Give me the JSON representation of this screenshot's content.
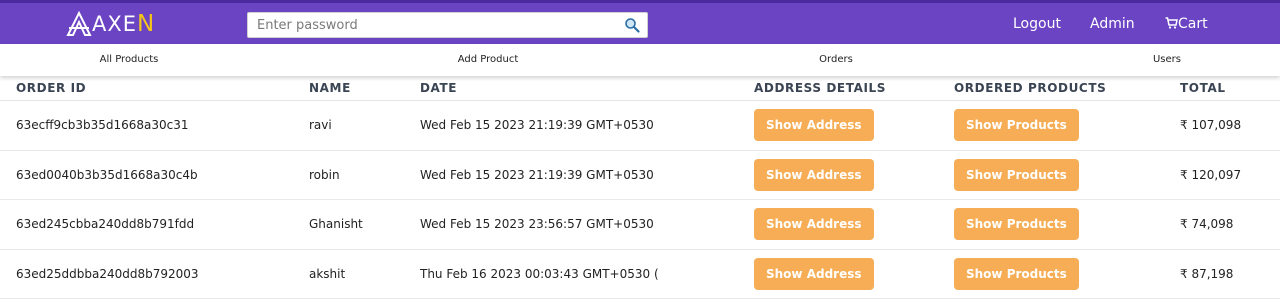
{
  "header": {
    "brand_prefix": "AXE",
    "brand_suffix": "N",
    "search": {
      "placeholder": "Enter password",
      "value": ""
    },
    "nav": {
      "logout": "Logout",
      "admin": "Admin",
      "cart": "Cart"
    },
    "colors": {
      "bar": "#6b44c4",
      "accent": "#f5c518"
    }
  },
  "subnav": {
    "items": [
      "All Products",
      "Add Product",
      "Orders",
      "Users"
    ]
  },
  "table": {
    "columns": [
      "ORDER ID",
      "NAME",
      "DATE",
      "ADDRESS DETAILS",
      "ORDERED PRODUCTS",
      "TOTAL"
    ],
    "rows": [
      {
        "order_id": "63ecff9cb3b35d1668a30c31",
        "name": "ravi",
        "date": "Wed Feb 15 2023 21:19:39 GMT+0530",
        "address_btn": "Show Address",
        "products_btn": "Show Products",
        "total": "₹ 107,098"
      },
      {
        "order_id": "63ed0040b3b35d1668a30c4b",
        "name": "robin",
        "date": "Wed Feb 15 2023 21:19:39 GMT+0530",
        "address_btn": "Show Address",
        "products_btn": "Show Products",
        "total": "₹ 120,097"
      },
      {
        "order_id": "63ed245cbba240dd8b791fdd",
        "name": "Ghanisht",
        "date": "Wed Feb 15 2023 23:56:57 GMT+0530",
        "address_btn": "Show Address",
        "products_btn": "Show Products",
        "total": "₹ 74,098"
      },
      {
        "order_id": "63ed25ddbba240dd8b792003",
        "name": "akshit",
        "date": "Thu Feb 16 2023 00:03:43 GMT+0530 (",
        "address_btn": "Show Address",
        "products_btn": "Show Products",
        "total": "₹ 87,198"
      }
    ],
    "button_color": "#f6ad55"
  }
}
